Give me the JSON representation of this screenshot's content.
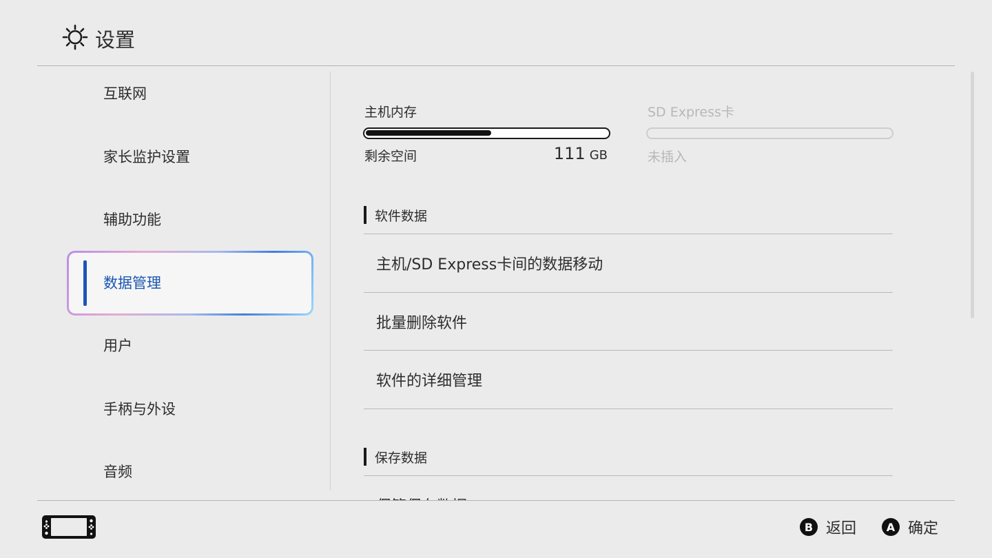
{
  "header": {
    "title": "设置",
    "icon": "sun-settings-icon"
  },
  "sidebar": {
    "items": [
      {
        "label": "互联网"
      },
      {
        "label": "家长监护设置"
      },
      {
        "label": "辅助功能"
      },
      {
        "label": "数据管理",
        "selected": true
      },
      {
        "label": "用户"
      },
      {
        "label": "手柄与外设"
      },
      {
        "label": "音频"
      }
    ]
  },
  "storage": {
    "system": {
      "label": "主机内存",
      "free_label": "剩余空间",
      "free_value": "111",
      "free_unit": "GB",
      "used_fraction": 0.52
    },
    "sd_card": {
      "label": "SD Express卡",
      "status": "未插入",
      "enabled": false
    }
  },
  "sections": {
    "software": {
      "heading": "软件数据",
      "items": [
        {
          "label": "主机/SD Express卡间的数据移动"
        },
        {
          "label": "批量删除软件"
        },
        {
          "label": "软件的详细管理"
        }
      ]
    },
    "save": {
      "heading": "保存数据",
      "items": [
        {
          "label": "保管保存数据"
        }
      ]
    }
  },
  "footer": {
    "back": {
      "key": "B",
      "label": "返回"
    },
    "confirm": {
      "key": "A",
      "label": "确定"
    }
  },
  "colors": {
    "accent": "#1b56b0",
    "background": "#ebebeb"
  }
}
